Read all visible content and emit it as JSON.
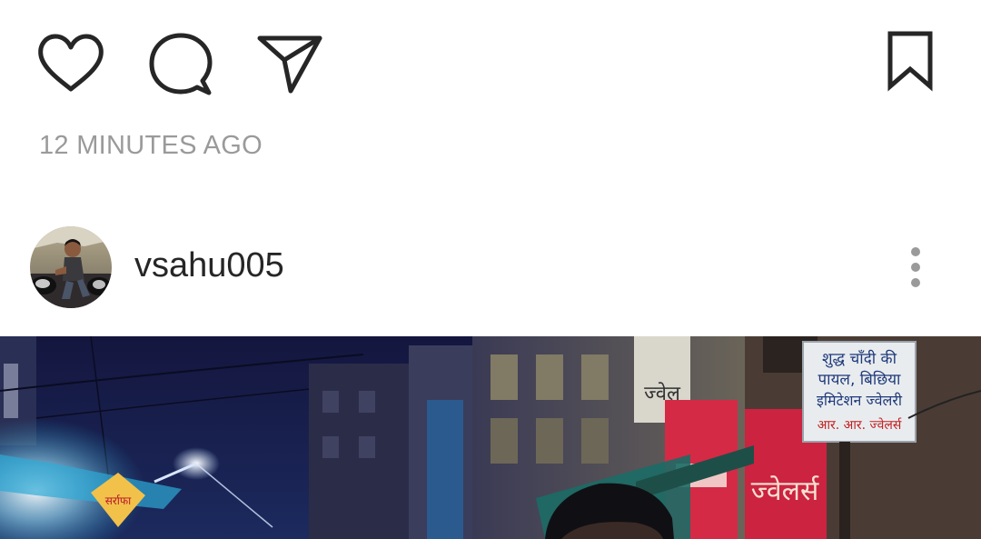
{
  "actions": {
    "like_icon": "heart-outline",
    "comment_icon": "speech-bubble-outline",
    "share_icon": "paper-plane-outline",
    "save_icon": "bookmark-outline"
  },
  "timestamp": "12 MINUTES AGO",
  "post": {
    "username": "vsahu005",
    "avatar": "profile-photo",
    "more_icon": "vertical-ellipsis",
    "image": "night-street-photo",
    "signboards": {
      "sign_1_line_1": "शुद्ध चाँदी की",
      "sign_1_line_2": "पायल, बिछिया",
      "sign_1_line_3": "इमिटेशन ज्वेलरी",
      "sign_1_line_4": "आर. आर. ज्वेलर्स",
      "sign_2": "ज्वेल",
      "sign_3": "ज्वेलर्स",
      "sign_4": "सर्राफा"
    }
  },
  "colors": {
    "icon_stroke": "#262626",
    "timestamp_text": "#9a9a9a",
    "username_text": "#262626",
    "background": "#ffffff",
    "photo_sky": "#14163e",
    "shop_red": "#d42a46"
  }
}
